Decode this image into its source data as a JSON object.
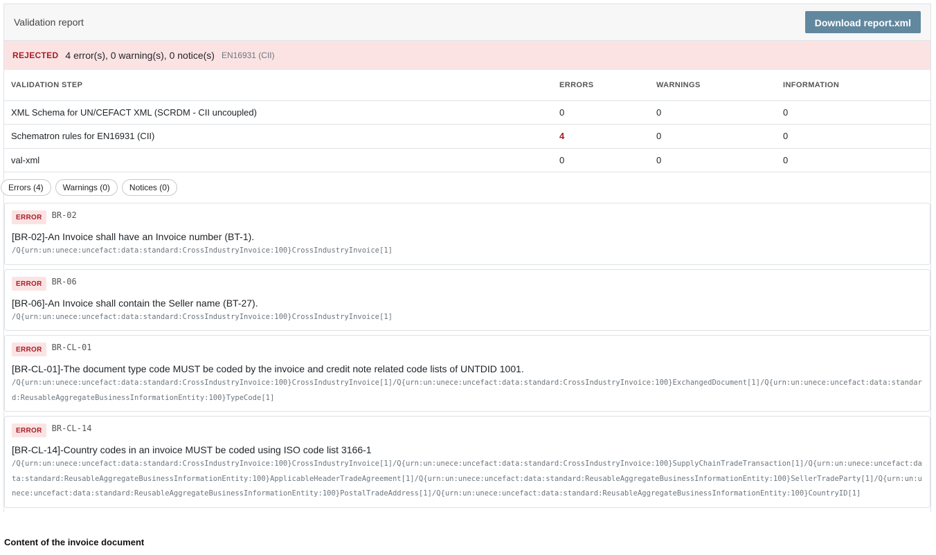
{
  "header": {
    "title": "Validation report",
    "download_label": "Download report.xml"
  },
  "status": {
    "label": "REJECTED",
    "summary": "4 error(s), 0 warning(s), 0 notice(s)",
    "standard": "EN16931 (CII)"
  },
  "steps": {
    "columns": [
      "VALIDATION STEP",
      "ERRORS",
      "WARNINGS",
      "INFORMATION"
    ],
    "rows": [
      {
        "name": "XML Schema for UN/CEFACT XML (SCRDM - CII uncoupled)",
        "errors": "0",
        "warnings": "0",
        "information": "0"
      },
      {
        "name": "Schematron rules for EN16931 (CII)",
        "errors": "4",
        "warnings": "0",
        "information": "0"
      },
      {
        "name": "val-xml",
        "errors": "0",
        "warnings": "0",
        "information": "0"
      }
    ]
  },
  "filters": {
    "errors": "Errors (4)",
    "warnings": "Warnings (0)",
    "notices": "Notices (0)"
  },
  "errors": [
    {
      "badge": "ERROR",
      "code": "BR-02",
      "message": "[BR-02]-An Invoice shall have an Invoice number (BT-1).",
      "path": "/Q{urn:un:unece:uncefact:data:standard:CrossIndustryInvoice:100}CrossIndustryInvoice[1]"
    },
    {
      "badge": "ERROR",
      "code": "BR-06",
      "message": "[BR-06]-An Invoice shall contain the Seller name (BT-27).",
      "path": "/Q{urn:un:unece:uncefact:data:standard:CrossIndustryInvoice:100}CrossIndustryInvoice[1]"
    },
    {
      "badge": "ERROR",
      "code": "BR-CL-01",
      "message": "[BR-CL-01]-The document type code MUST be coded by the invoice and credit note related code lists of UNTDID 1001.",
      "path": "/Q{urn:un:unece:uncefact:data:standard:CrossIndustryInvoice:100}CrossIndustryInvoice[1]/Q{urn:un:unece:uncefact:data:standard:CrossIndustryInvoice:100}ExchangedDocument[1]/Q{urn:un:unece:uncefact:data:standard:ReusableAggregateBusinessInformationEntity:100}TypeCode[1]"
    },
    {
      "badge": "ERROR",
      "code": "BR-CL-14",
      "message": "[BR-CL-14]-Country codes in an invoice MUST be coded using ISO code list 3166-1",
      "path": "/Q{urn:un:unece:uncefact:data:standard:CrossIndustryInvoice:100}CrossIndustryInvoice[1]/Q{urn:un:unece:uncefact:data:standard:CrossIndustryInvoice:100}SupplyChainTradeTransaction[1]/Q{urn:un:unece:uncefact:data:standard:ReusableAggregateBusinessInformationEntity:100}ApplicableHeaderTradeAgreement[1]/Q{urn:un:unece:uncefact:data:standard:ReusableAggregateBusinessInformationEntity:100}SellerTradeParty[1]/Q{urn:un:unece:uncefact:data:standard:ReusableAggregateBusinessInformationEntity:100}PostalTradeAddress[1]/Q{urn:un:unece:uncefact:data:standard:ReusableAggregateBusinessInformationEntity:100}CountryID[1]"
    }
  ],
  "content_title": "Content of the invoice document",
  "colors": {
    "rejected": "#a51d24",
    "status_bg": "#fbe3e4",
    "button": "#62889f"
  }
}
